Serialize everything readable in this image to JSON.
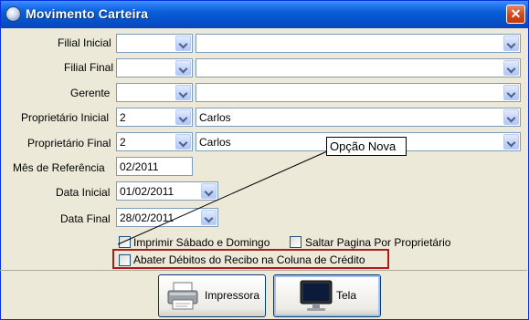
{
  "window": {
    "title": "Movimento Carteira",
    "close_glyph": "✕",
    "icon": "app-icon"
  },
  "form": {
    "filial_inicial": {
      "label": "Filial Inicial",
      "code": "",
      "name": ""
    },
    "filial_final": {
      "label": "Filial Final",
      "code": "",
      "name": ""
    },
    "gerente": {
      "label": "Gerente",
      "code": "",
      "name": ""
    },
    "proprietario_inicial": {
      "label": "Proprietário Inicial",
      "code": "2",
      "name": "Carlos"
    },
    "proprietario_final": {
      "label": "Proprietário Final",
      "code": "2",
      "name": "Carlos"
    },
    "mes_referencia": {
      "label": "Mês de Referência",
      "value": "02/2011"
    },
    "data_inicial": {
      "label": "Data Inicial",
      "value": "01/02/2011"
    },
    "data_final": {
      "label": "Data Final",
      "value": "28/02/2011"
    }
  },
  "options": {
    "imprimir_sabado_domingo": {
      "label": "Imprimir Sábado e Domingo",
      "checked": false
    },
    "saltar_pagina": {
      "label": "Saltar Pagina Por Proprietário",
      "checked": false
    },
    "abater_debitos": {
      "label": "Abater Débitos do Recibo na Coluna de Crédito",
      "checked": false
    }
  },
  "annotation": {
    "text": "Opção Nova"
  },
  "buttons": {
    "impressora": {
      "label": "Impressora",
      "icon": "printer-icon"
    },
    "tela": {
      "label": "Tela",
      "icon": "monitor-icon"
    }
  },
  "colors": {
    "title_bar": "#0553cc",
    "highlight_box": "#b2191b",
    "window_bg": "#ece9d8"
  }
}
